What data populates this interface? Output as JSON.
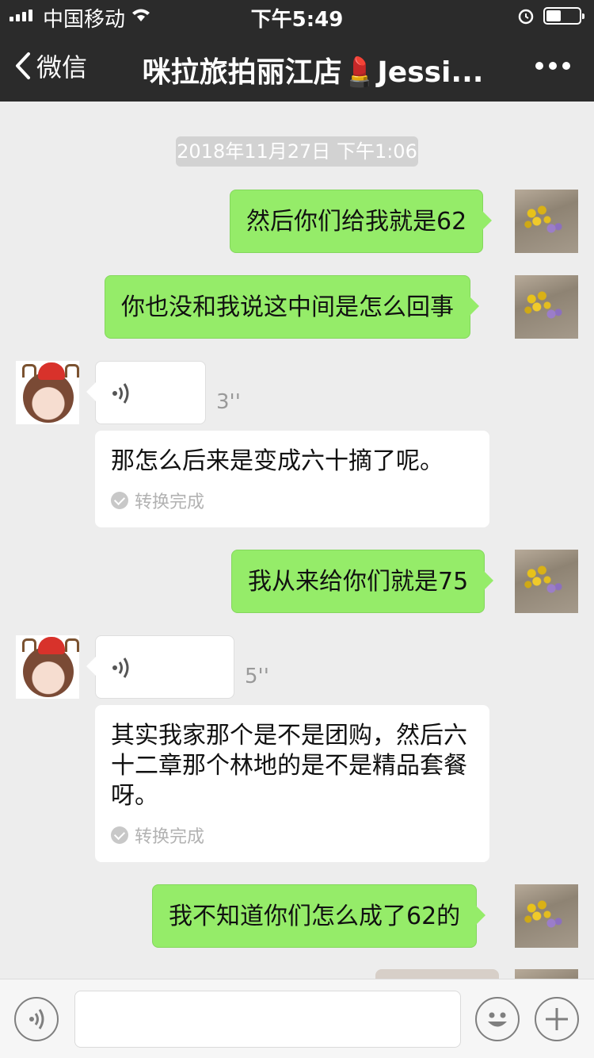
{
  "status_bar": {
    "carrier": "中国移动",
    "time": "下午5:49"
  },
  "nav": {
    "back_label": "微信",
    "title": "咪拉旅拍丽江店💄Jessi..."
  },
  "chat": {
    "timestamp": "2018年11月27日 下午1:06",
    "messages": [
      {
        "dir": "out",
        "type": "text",
        "text": "然后你们给我就是62"
      },
      {
        "dir": "out",
        "type": "text",
        "text": "你也没和我说这中间是怎么回事"
      },
      {
        "dir": "in",
        "type": "voice",
        "duration": "3''",
        "transcript": "那怎么后来是变成六十摘了呢。",
        "status": "转换完成"
      },
      {
        "dir": "out",
        "type": "text",
        "text": "我从来给你们就是75"
      },
      {
        "dir": "in",
        "type": "voice",
        "duration": "5''",
        "transcript": "其实我家那个是不是团购，然后六十二章那个林地的是不是精品套餐呀。",
        "status": "转换完成"
      },
      {
        "dir": "out",
        "type": "text",
        "text": "我不知道你们怎么成了62的"
      }
    ]
  },
  "colors": {
    "outgoing_bubble": "#95ec69",
    "nav_bg": "#2b2b2b",
    "chat_bg": "#ededed"
  }
}
